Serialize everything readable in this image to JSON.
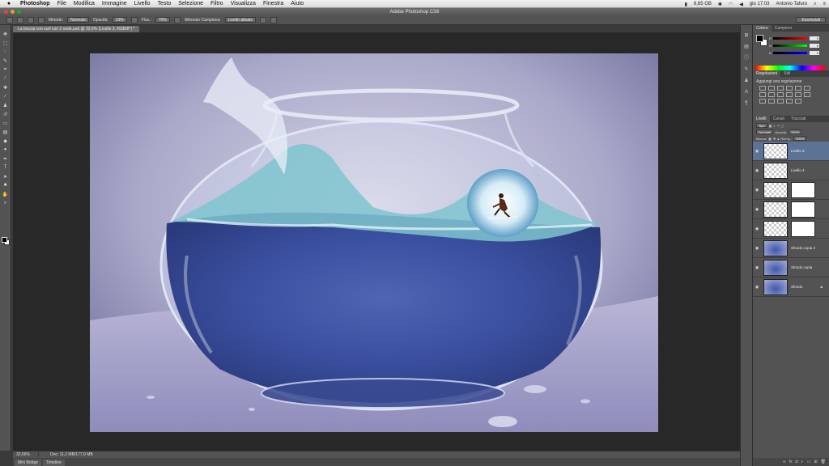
{
  "menubar": {
    "apple": "",
    "items": [
      "Photoshop",
      "File",
      "Modifica",
      "Immagine",
      "Livello",
      "Testo",
      "Selezione",
      "Filtro",
      "Visualizza",
      "Finestra",
      "Aiuto"
    ],
    "status": [
      "6,65 GB",
      "gio 17:03",
      "Antonio Tafuro"
    ]
  },
  "window": {
    "title": "Adobe Photoshop CS6"
  },
  "options": {
    "mode_label": "Metodo:",
    "mode_value": "Normale",
    "opacity_label": "Opacità:",
    "opacity_value": "13%",
    "flow_label": "Flus.:",
    "flow_value": "70%",
    "aligned_label": "Allineato Campiona:",
    "sample_value": "Livello attuale",
    "workspace": "Essenziali"
  },
  "document": {
    "tab": "La boccia con surf con 2 onde.psd @ 32,6% (Livello 3, RGB/8*) *",
    "zoom": "32,56%",
    "doc_size": "Doc: 11,2 MB/177,9 MB"
  },
  "bottom_tabs": [
    "Mini Bridge",
    "Timeline"
  ],
  "color_panel": {
    "tabs": [
      "Colore",
      "Campioni"
    ],
    "channels": [
      {
        "label": "R",
        "value": "0"
      },
      {
        "label": "G",
        "value": "0"
      },
      {
        "label": "B",
        "value": "0"
      }
    ]
  },
  "adjustments_panel": {
    "tabs": [
      "Regolazioni",
      "Stili"
    ],
    "title": "Aggiungi una regolazione"
  },
  "layers_panel": {
    "tabs": [
      "Livelli",
      "Canali",
      "Tracciati"
    ],
    "kind_label": "Tipo",
    "blend_mode": "Normale",
    "opacity_label": "Opacità:",
    "opacity_value": "100%",
    "lock_label": "Blocca:",
    "fill_label": "Riemp.:",
    "fill_value": "100%",
    "layers": [
      {
        "name": "Livello 3",
        "selected": true
      },
      {
        "name": "Livello 4",
        "selected": false
      },
      {
        "name": "",
        "selected": false
      },
      {
        "name": "",
        "selected": false
      },
      {
        "name": "",
        "selected": false
      },
      {
        "name": "Sfondo copia 2",
        "selected": false
      },
      {
        "name": "Sfondo copia",
        "selected": false
      },
      {
        "name": "Sfondo",
        "selected": false
      }
    ]
  },
  "icons": {
    "eye": "eye-icon",
    "lock": "lock-icon",
    "link": "link-icon",
    "fx": "fx-icon",
    "mask": "mask-icon",
    "new_layer": "new-layer-icon",
    "trash": "trash-icon"
  }
}
